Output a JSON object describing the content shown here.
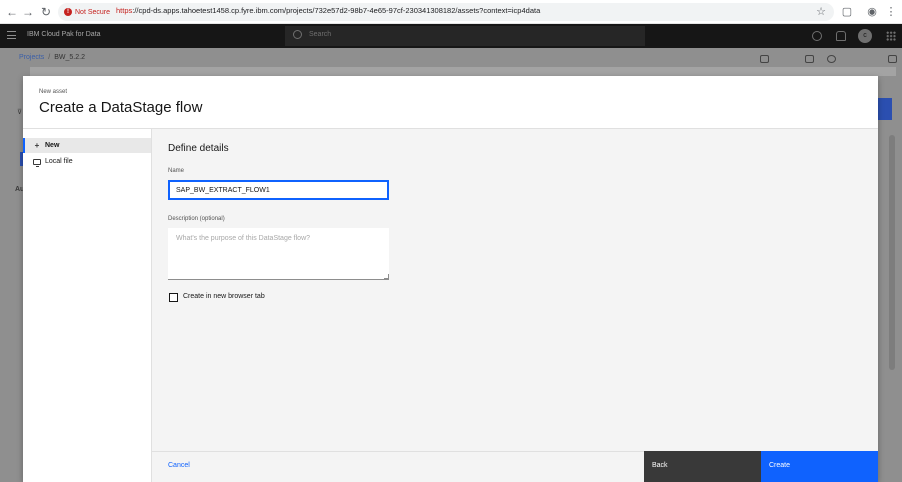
{
  "browser": {
    "security_label": "Not Secure",
    "url_scheme": "https",
    "url_rest": "://cpd-ds.apps.tahoetest1458.cp.fyre.ibm.com/projects/732e57d2-98b7-4e65-97cf-230341308182/assets?context=icp4data"
  },
  "app_header": {
    "title": "IBM Cloud Pak for Data",
    "search_placeholder": "Search",
    "avatar_initial": "c"
  },
  "underlying": {
    "breadcrumb": [
      "Projects",
      "/",
      "BW_5.2.2"
    ],
    "left_text": "Au"
  },
  "modal": {
    "label": "New asset",
    "title": "Create a DataStage flow",
    "sidebar": [
      {
        "icon": "plus-icon",
        "label": "New"
      },
      {
        "icon": "monitor-icon",
        "label": "Local file"
      }
    ],
    "section_title": "Define details",
    "name_label": "Name",
    "name_value": "SAP_BW_EXTRACT_FLOW1",
    "description_label": "Description (optional)",
    "description_placeholder": "What's the purpose of this DataStage flow?",
    "checkbox_label": "Create in new browser tab",
    "checkbox_checked": false,
    "cancel_label": "Cancel",
    "back_label": "Back",
    "create_label": "Create"
  },
  "colors": {
    "primary_blue": "#0f62fe",
    "back_button": "#393939",
    "header_dark": "#161616"
  }
}
